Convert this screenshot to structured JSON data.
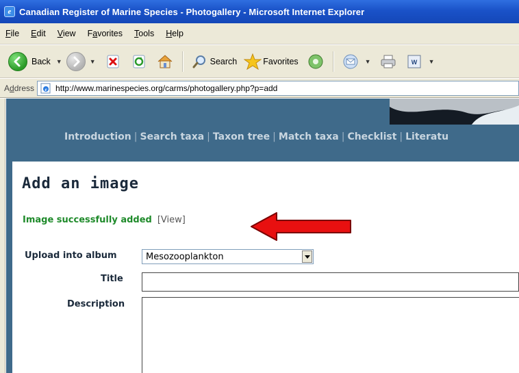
{
  "window": {
    "title": "Canadian Register of Marine Species - Photogallery - Microsoft Internet Explorer"
  },
  "menu": {
    "items": [
      {
        "label": "File",
        "u": "F",
        "rest": "ile"
      },
      {
        "label": "Edit",
        "u": "E",
        "rest": "dit"
      },
      {
        "label": "View",
        "u": "V",
        "rest": "iew"
      },
      {
        "label": "Favorites",
        "u_pre": "F",
        "u": "a",
        "rest": "vorites"
      },
      {
        "label": "Tools",
        "u": "T",
        "rest": "ools"
      },
      {
        "label": "Help",
        "u": "H",
        "rest": "elp"
      }
    ]
  },
  "toolbar": {
    "back_label": "Back",
    "search_label": "Search",
    "favorites_label": "Favorites"
  },
  "address": {
    "label_u": "d",
    "label_pre": "A",
    "label_rest": "dress",
    "url": "http://www.marinespecies.org/carms/photogallery.php?p=add"
  },
  "nav": {
    "links": [
      "Introduction",
      "Search taxa",
      "Taxon tree",
      "Match taxa",
      "Checklist",
      "Literatu"
    ]
  },
  "page": {
    "heading": "Add an image",
    "success_message": "Image successfully added",
    "view_link": "[View]"
  },
  "form": {
    "album_label": "Upload into album",
    "album_value": "Mesozooplankton",
    "title_label": "Title",
    "title_value": "",
    "description_label": "Description",
    "description_value": ""
  },
  "colors": {
    "arrow": "#e81010",
    "success": "#1e8a2a",
    "banner": "#3f6a8a"
  }
}
